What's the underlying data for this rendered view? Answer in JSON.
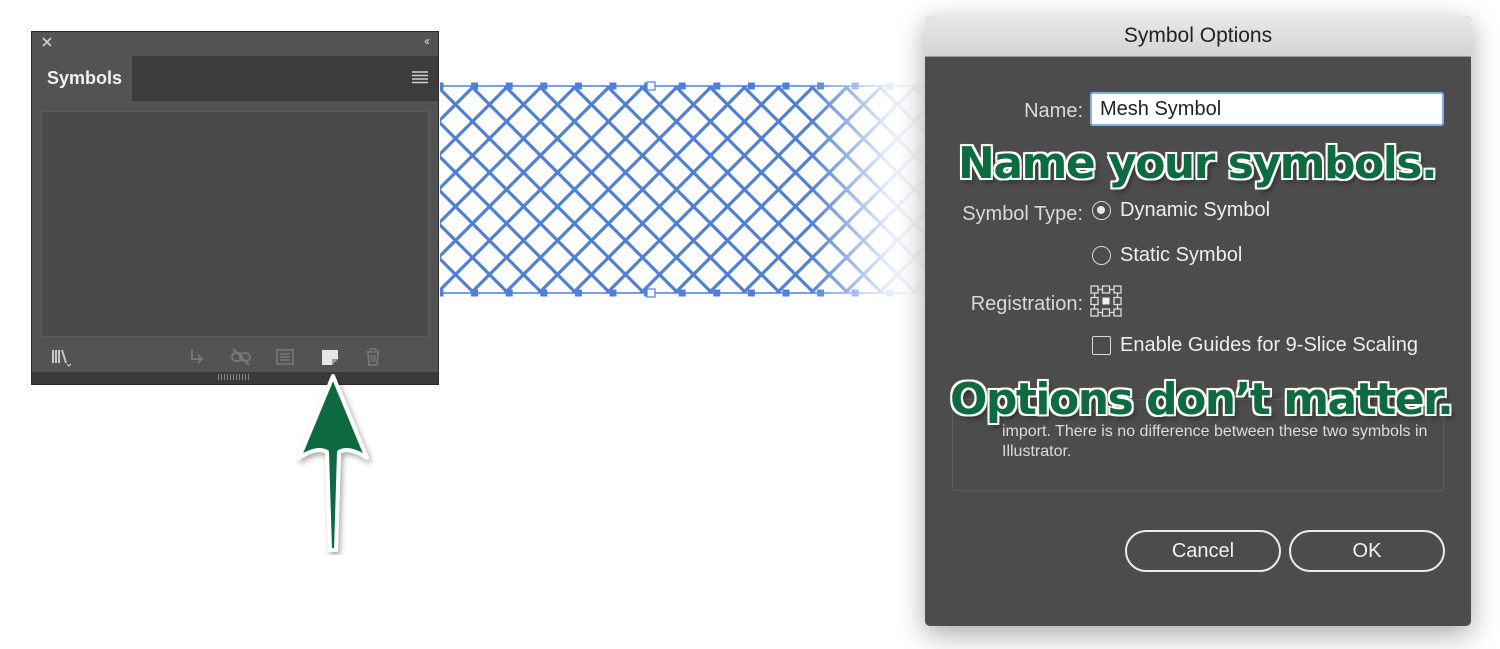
{
  "symbols_panel": {
    "tab_title": "Symbols",
    "collapse_glyph": "‹‹",
    "icons": [
      "symbol-libraries-icon",
      "place-symbol-icon",
      "break-link-icon",
      "symbol-options-icon",
      "new-symbol-icon",
      "delete-symbol-icon"
    ]
  },
  "dialog": {
    "title": "Symbol Options",
    "name_label": "Name:",
    "name_value": "Mesh Symbol",
    "symbol_type_label": "Symbol Type:",
    "dynamic_option": "Dynamic Symbol",
    "static_option": "Static Symbol",
    "selected_type": "Dynamic Symbol",
    "registration_label": "Registration:",
    "guides_checkbox": "Enable Guides for 9-Slice Scaling",
    "guides_checked": false,
    "description": "import. There is no difference between these two symbols in Illustrator.",
    "cancel_label": "Cancel",
    "ok_label": "OK"
  },
  "callouts": {
    "name_tip": "Name your symbols.",
    "options_tip": "Options don’t matter."
  },
  "colors": {
    "mesh_blue": "#4f7fdc",
    "callout_green": "#0e6b3f",
    "panel_gray": "#535353",
    "dialog_gray": "#4c4c4c"
  }
}
